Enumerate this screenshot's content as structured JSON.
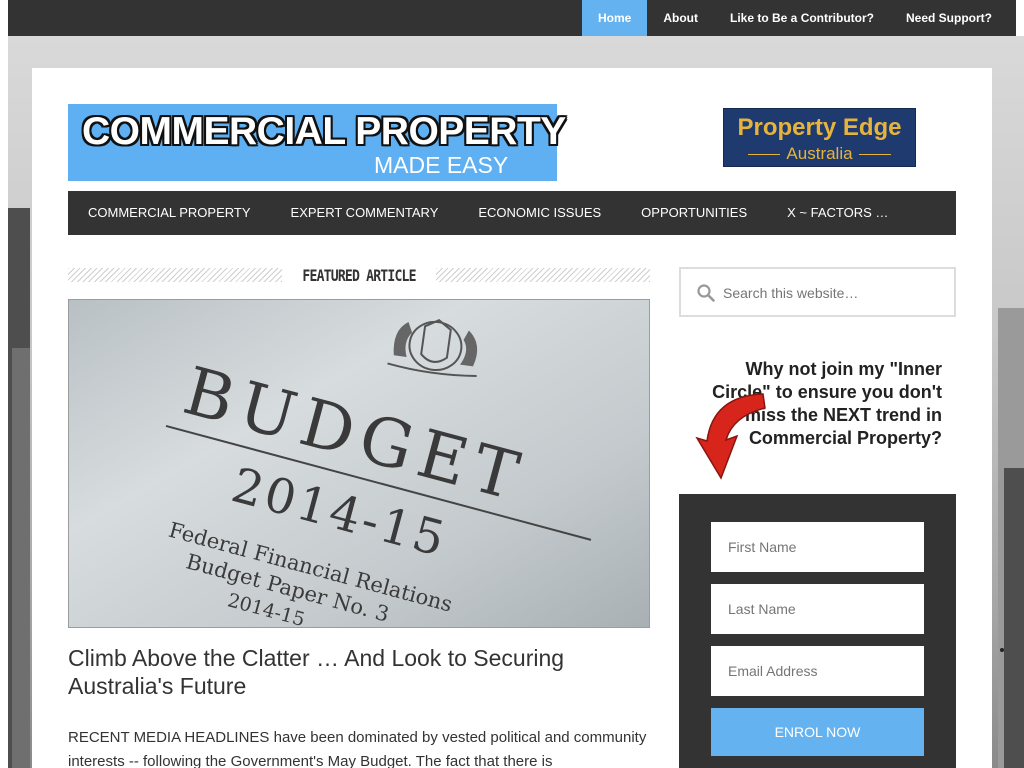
{
  "topnav": {
    "items": [
      {
        "label": "Home",
        "active": true
      },
      {
        "label": "About",
        "active": false
      },
      {
        "label": "Like to Be a Contributor?",
        "active": false
      },
      {
        "label": "Need Support?",
        "active": false
      }
    ]
  },
  "header": {
    "logo_line1": "COMMERCIAL PROPERTY",
    "logo_line2": "MADE EASY",
    "badge_line1": "Property Edge",
    "badge_line2": "Australia"
  },
  "mainnav": {
    "items": [
      "COMMERCIAL PROPERTY",
      "EXPERT COMMENTARY",
      "ECONOMIC ISSUES",
      "OPPORTUNITIES",
      "X ~ FACTORS …"
    ]
  },
  "featured": {
    "section_label": "FEATURED ARTICLE",
    "image_text": {
      "title": "BUDGET",
      "year": "2014-15",
      "line1": "Federal Financial Relations",
      "line2": "Budget Paper No. 3",
      "line3": "2014-15"
    },
    "article_title": "Climb Above the Clatter … And Look to Securing Australia's Future",
    "article_excerpt": "RECENT MEDIA HEADLINES have been dominated by vested political and community interests -- following the Government's May Budget. The fact that there is"
  },
  "sidebar": {
    "search_placeholder": "Search this website…",
    "inner_circle_text": "Why not join my \"Inner Circle\" to ensure you don't miss the NEXT trend in Commercial Property?",
    "signup": {
      "first_name_placeholder": "First Name",
      "last_name_placeholder": "Last Name",
      "email_placeholder": "Email Address",
      "button_label": "ENROL NOW"
    }
  },
  "colors": {
    "accent": "#64b3f0",
    "nav_bg": "#333333",
    "badge_bg": "#1f3a6e",
    "badge_text": "#e6b43c"
  }
}
